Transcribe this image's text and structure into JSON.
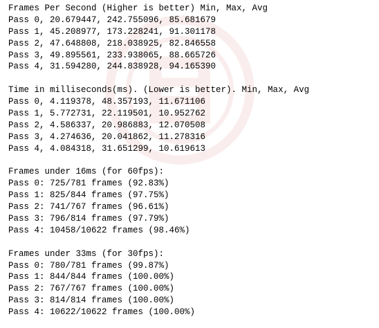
{
  "sections": [
    {
      "heading": "Frames Per Second (Higher is better) Min, Max, Avg",
      "lines": [
        "Pass 0, 20.679447, 242.755096, 85.681679",
        "Pass 1, 45.208977, 173.228241, 91.301178",
        "Pass 2, 47.648808, 218.038925, 82.846558",
        "Pass 3, 49.895561, 233.938065, 88.665726",
        "Pass 4, 31.594280, 244.838928, 94.165390"
      ]
    },
    {
      "heading": "Time in milliseconds(ms). (Lower is better). Min, Max, Avg",
      "lines": [
        "Pass 0, 4.119378, 48.357193, 11.671106",
        "Pass 1, 5.772731, 22.119501, 10.952762",
        "Pass 2, 4.586337, 20.986883, 12.070508",
        "Pass 3, 4.274636, 20.041862, 11.278316",
        "Pass 4, 4.084318, 31.651299, 10.619613"
      ]
    },
    {
      "heading": "Frames under 16ms (for 60fps):",
      "lines": [
        "Pass 0: 725/781 frames (92.83%)",
        "Pass 1: 825/844 frames (97.75%)",
        "Pass 2: 741/767 frames (96.61%)",
        "Pass 3: 796/814 frames (97.79%)",
        "Pass 4: 10458/10622 frames (98.46%)"
      ]
    },
    {
      "heading": "Frames under 33ms (for 30fps):",
      "lines": [
        "Pass 0: 780/781 frames (99.87%)",
        "Pass 1: 844/844 frames (100.00%)",
        "Pass 2: 767/767 frames (100.00%)",
        "Pass 3: 814/814 frames (100.00%)",
        "Pass 4: 10622/10622 frames (100.00%)"
      ]
    }
  ],
  "watermark": {
    "color": "#c62828",
    "icon": "watermark-emblem-icon"
  }
}
